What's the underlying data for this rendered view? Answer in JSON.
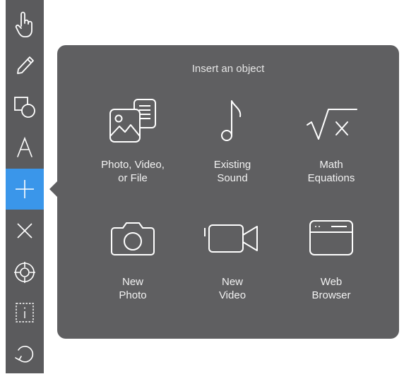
{
  "toolbar": {
    "tools": [
      {
        "name": "hand-pointer-icon"
      },
      {
        "name": "pencil-icon"
      },
      {
        "name": "shapes-icon"
      },
      {
        "name": "text-icon",
        "glyph": "A"
      },
      {
        "name": "plus-icon",
        "active": true
      },
      {
        "name": "close-icon"
      },
      {
        "name": "crosshair-icon"
      },
      {
        "name": "info-box-icon",
        "glyph": "i"
      },
      {
        "name": "undo-icon"
      }
    ],
    "colors": {
      "background": "#5b5b5d",
      "active": "#3a96ea"
    }
  },
  "popover": {
    "title": "Insert an object",
    "background": "#5f5f61",
    "items": [
      {
        "icon": "photo-file-icon",
        "line1": "Photo, Video,",
        "line2": "or File"
      },
      {
        "icon": "music-note-icon",
        "line1": "Existing",
        "line2": "Sound"
      },
      {
        "icon": "math-equation-icon",
        "line1": "Math",
        "line2": "Equations"
      },
      {
        "icon": "camera-icon",
        "line1": "New",
        "line2": "Photo"
      },
      {
        "icon": "video-camera-icon",
        "line1": "New",
        "line2": "Video"
      },
      {
        "icon": "web-browser-icon",
        "line1": "Web",
        "line2": "Browser"
      }
    ]
  }
}
